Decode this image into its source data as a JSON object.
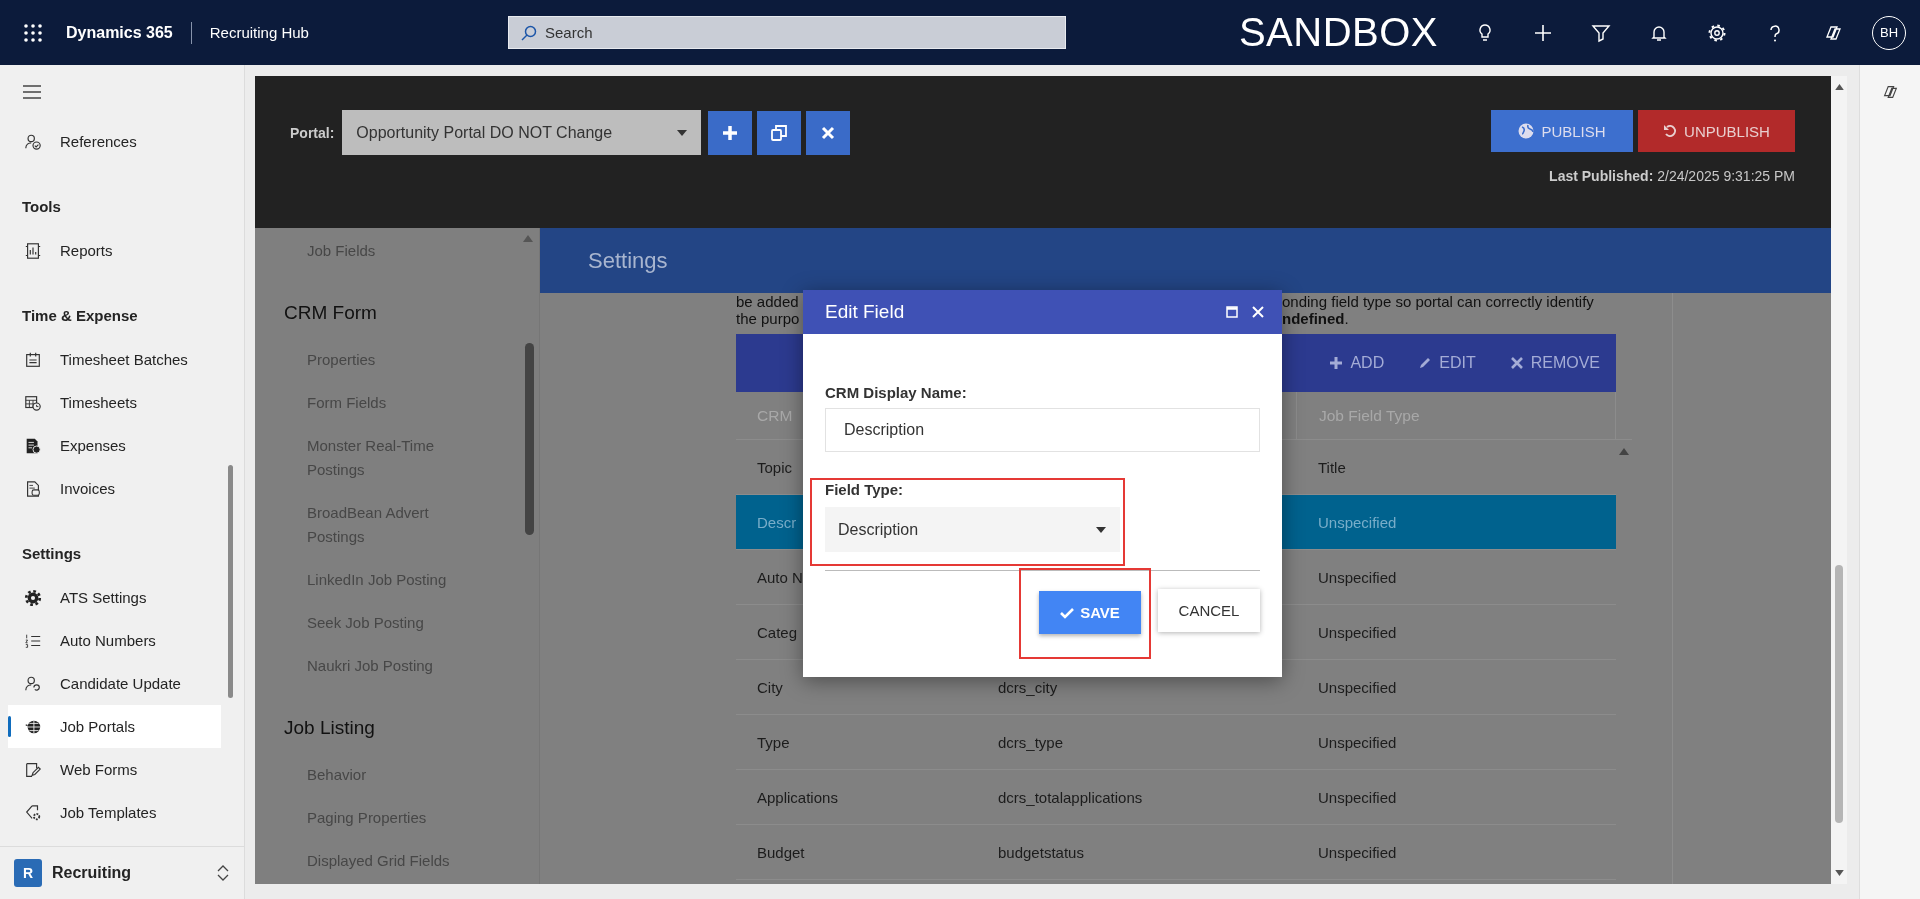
{
  "topbar": {
    "app": "Dynamics 365",
    "area": "Recruiting Hub",
    "search": {
      "placeholder": "Search"
    },
    "environment": "SANDBOX",
    "avatar": "BH"
  },
  "sidebar": {
    "sections": [
      {
        "items": [
          {
            "label": "References",
            "selected": false
          }
        ]
      },
      {
        "title": "Tools",
        "items": [
          {
            "label": "Reports",
            "selected": false
          }
        ]
      },
      {
        "title": "Time & Expense",
        "items": [
          {
            "label": "Timesheet Batches",
            "selected": false
          },
          {
            "label": "Timesheets",
            "selected": false
          },
          {
            "label": "Expenses",
            "selected": false
          },
          {
            "label": "Invoices",
            "selected": false
          }
        ]
      },
      {
        "title": "Settings",
        "items": [
          {
            "label": "ATS Settings",
            "selected": false
          },
          {
            "label": "Auto Numbers",
            "selected": false
          },
          {
            "label": "Candidate Update",
            "selected": false
          },
          {
            "label": "Job Portals",
            "selected": true
          },
          {
            "label": "Web Forms",
            "selected": false
          },
          {
            "label": "Job Templates",
            "selected": false
          }
        ]
      }
    ],
    "area": {
      "badge": "R",
      "label": "Recruiting"
    }
  },
  "portal": {
    "label": "Portal:",
    "selected_portal": "Opportunity Portal DO NOT Change",
    "publish": "PUBLISH",
    "unpublish": "UNPUBLISH",
    "last_published_label": "Last Published:",
    "last_published": "2/24/2025 9:31:25 PM"
  },
  "settings_nav": [
    {
      "kind": "item",
      "label": "Job Fields"
    },
    {
      "kind": "header",
      "label": "CRM Form"
    },
    {
      "kind": "item",
      "label": "Properties"
    },
    {
      "kind": "item",
      "label": "Form Fields"
    },
    {
      "kind": "item",
      "label": "Monster Real-Time Postings"
    },
    {
      "kind": "item",
      "label": "BroadBean Advert Postings"
    },
    {
      "kind": "item",
      "label": "LinkedIn Job Posting"
    },
    {
      "kind": "item",
      "label": "Seek Job Posting"
    },
    {
      "kind": "item",
      "label": "Naukri Job Posting"
    },
    {
      "kind": "header",
      "label": "Job Listing"
    },
    {
      "kind": "item",
      "label": "Behavior"
    },
    {
      "kind": "item",
      "label": "Paging Properties"
    },
    {
      "kind": "item",
      "label": "Displayed Grid Fields"
    }
  ],
  "settings": {
    "title": "Settings",
    "note_lines": [
      {
        "left": "be added",
        "right": "onding field type so portal can correctly identify"
      },
      {
        "left": "the purpo",
        "right": "**ndefined**."
      }
    ]
  },
  "table": {
    "actions": [
      "ADD",
      "EDIT",
      "REMOVE"
    ],
    "column_1": "CRM",
    "column_3": "Job Field Type",
    "rows": [
      {
        "name": "Topic",
        "field_type": "Title",
        "selected": false
      },
      {
        "name": "Descr",
        "field_type": "Unspecified",
        "selected": true
      },
      {
        "name": "Auto N",
        "field_type": "Unspecified",
        "selected": false
      },
      {
        "name": "Categ",
        "field_type": "Unspecified",
        "selected": false
      },
      {
        "name": "City",
        "schema": "dcrs_city",
        "field_type": "Unspecified",
        "selected": false
      },
      {
        "name": "Type",
        "schema": "dcrs_type",
        "field_type": "Unspecified",
        "selected": false
      },
      {
        "name": "Applications",
        "schema": "dcrs_totalapplications",
        "field_type": "Unspecified",
        "selected": false
      },
      {
        "name": "Budget",
        "schema": "budgetstatus",
        "field_type": "Unspecified",
        "selected": false
      }
    ]
  },
  "dialog": {
    "title": "Edit Field",
    "display_name_label": "CRM Display Name:",
    "display_name": "Description",
    "field_type_label": "Field Type:",
    "field_type": "Description",
    "field_type_highlighted": true,
    "save": "SAVE",
    "save_highlighted": true,
    "cancel": "CANCEL"
  }
}
